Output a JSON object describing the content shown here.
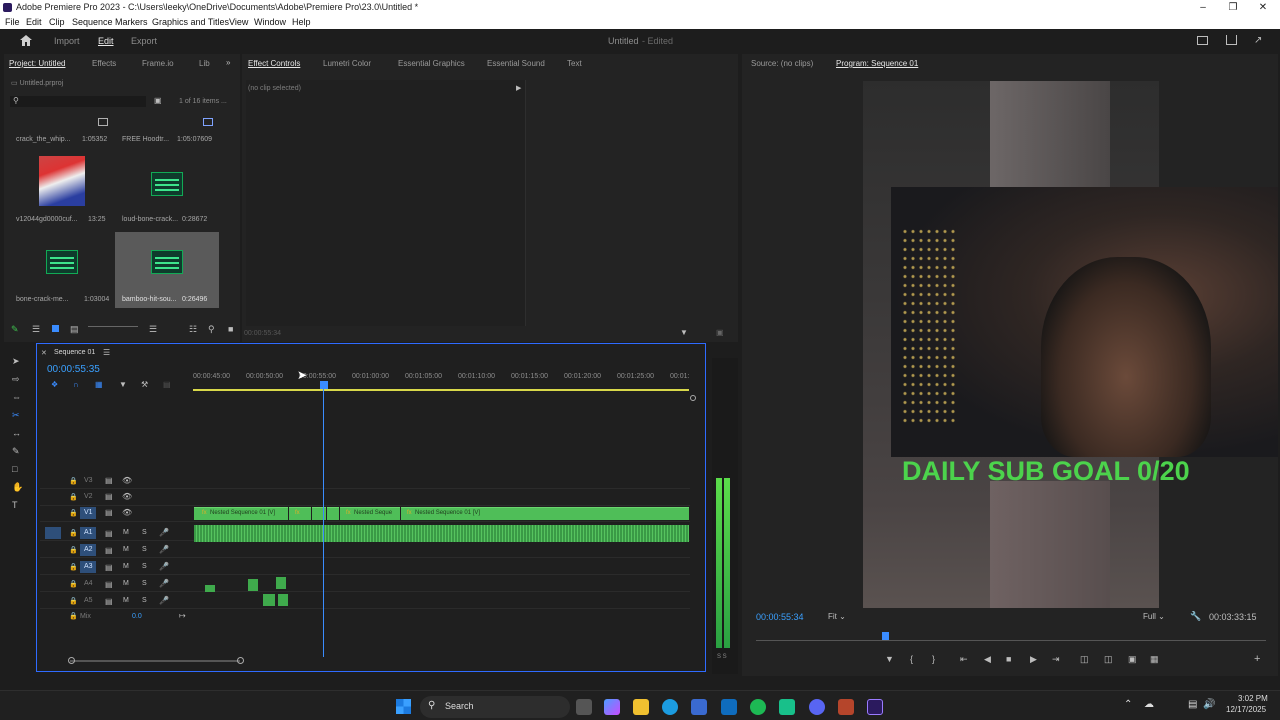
{
  "window": {
    "title": "Adobe Premiere Pro 2023 - C:\\Users\\leeky\\OneDrive\\Documents\\Adobe\\Premiere Pro\\23.0\\Untitled *"
  },
  "menu": [
    "File",
    "Edit",
    "Clip",
    "Sequence",
    "Markers",
    "Graphics and Titles",
    "View",
    "Window",
    "Help"
  ],
  "workspace": {
    "import": "Import",
    "edit": "Edit",
    "export": "Export",
    "project_title": "Untitled",
    "status": "- Edited"
  },
  "project_panel": {
    "tabs": [
      "Project: Untitled",
      "Effects",
      "Frame.io",
      "Lib"
    ],
    "file": "Untitled.prproj",
    "count": "1 of 16 items ...",
    "items": [
      {
        "name": "crack_the_whip...",
        "dur": "1:05352"
      },
      {
        "name": "FREE Hoodtr...",
        "dur": "1:05:07609"
      },
      {
        "name": "v12044gd0000cuf...",
        "dur": "13:25"
      },
      {
        "name": "loud-bone-crack...",
        "dur": "0:28672"
      },
      {
        "name": "bone-crack-me...",
        "dur": "1:03004"
      },
      {
        "name": "bamboo-hit-sou...",
        "dur": "0:26496"
      }
    ]
  },
  "effect_panel": {
    "tabs": [
      "Effect Controls",
      "Lumetri Color",
      "Essential Graphics",
      "Essential Sound",
      "Text"
    ],
    "no_clip": "(no clip selected)",
    "timecode": "00:00:55:34"
  },
  "source_panel": {
    "source_tab": "Source: (no clips)",
    "program_tab": "Program: Sequence 01",
    "overlay_text": "DAILY SUB GOAL 0/20",
    "timecode": "00:00:55:34",
    "fit": "Fit",
    "full": "Full",
    "duration": "00:03:33:15"
  },
  "timeline": {
    "tab": "Sequence 01",
    "timecode": "00:00:55:35",
    "ticks": [
      "00:00:45:00",
      "00:00:50:00",
      "00:00:55:00",
      "00:01:00:00",
      "00:01:05:00",
      "00:01:10:00",
      "00:01:15:00",
      "00:01:20:00",
      "00:01:25:00",
      "00:01:"
    ],
    "tracks": [
      "V3",
      "V2",
      "V1",
      "A1",
      "A2",
      "A3",
      "A4",
      "A5"
    ],
    "mix": "Mix",
    "mix_val": "0.0",
    "clips": [
      "Nested Sequence 01 [V]",
      "Nested Seque",
      "Nested Sequence 01 [V]"
    ]
  },
  "meter": {
    "label": "S S"
  },
  "taskbar": {
    "search": "Search",
    "time": "3:02 PM",
    "date": "12/17/2025"
  }
}
